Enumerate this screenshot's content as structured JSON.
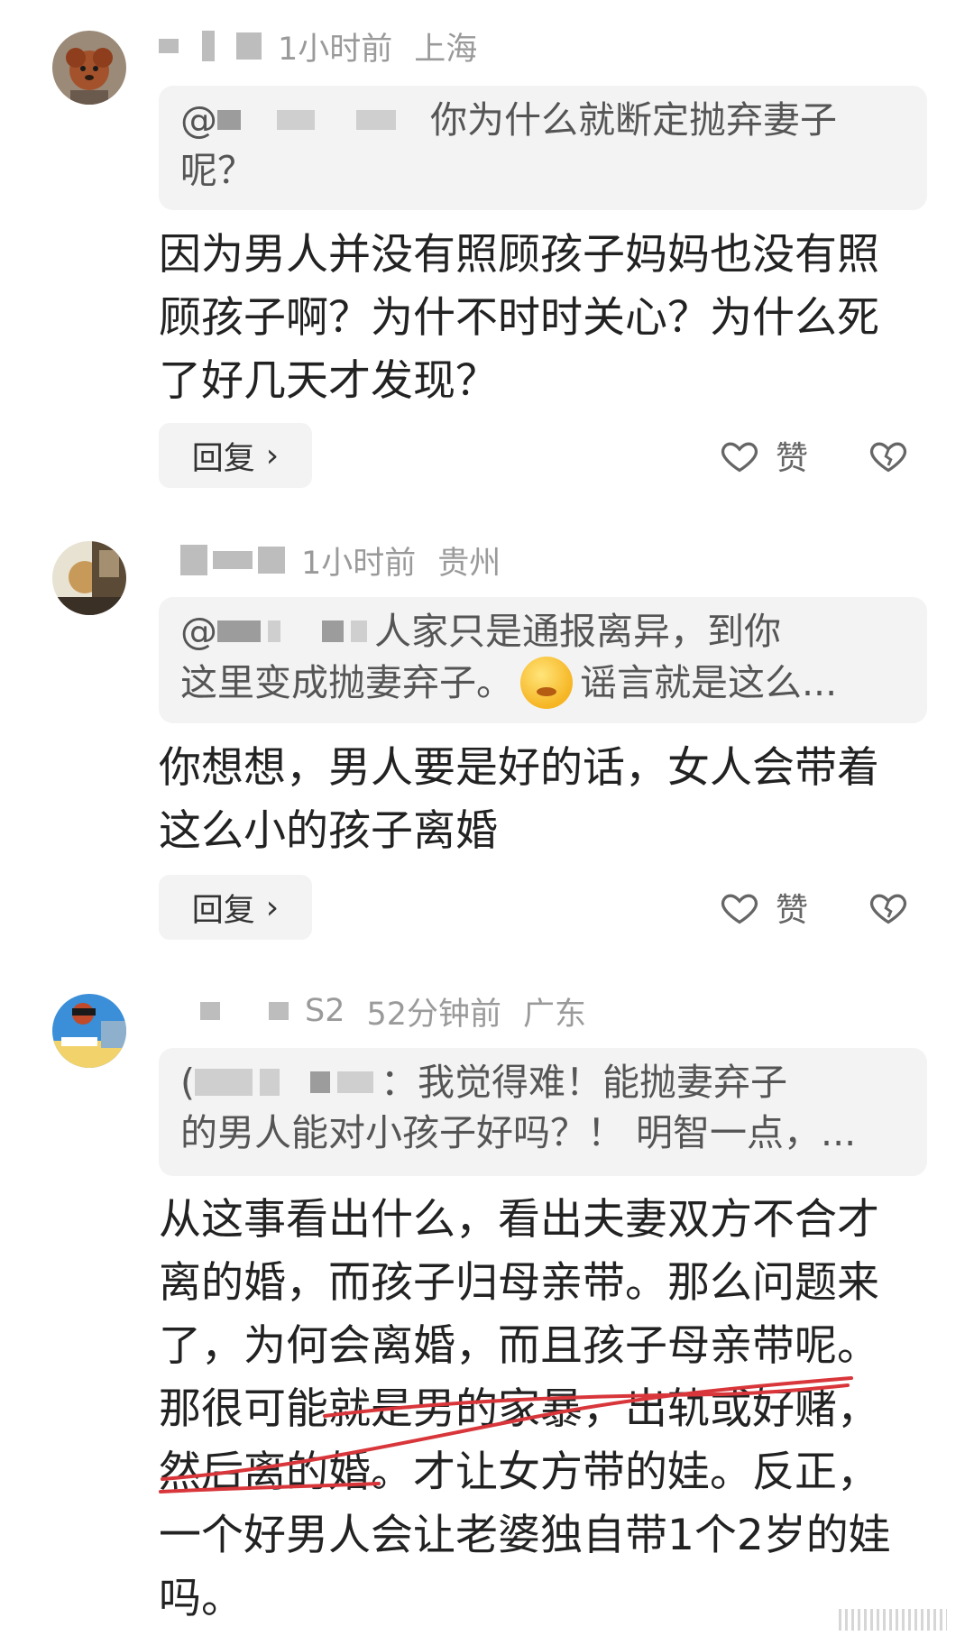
{
  "comments": [
    {
      "time": "1小时前",
      "location": "上海",
      "quote_text_1": "你为什么就断定抛弃妻子",
      "quote_text_2": "呢？",
      "body": [
        "因为男人并没有照顾孩子妈妈也没有照",
        "顾孩子啊？为什不时时关心？为什么死",
        "了好几天才发现？"
      ],
      "reply_label": "回复",
      "like_label": "赞"
    },
    {
      "time": "1小时前",
      "location": "贵州",
      "quote_text_1": "人家只是通报离异，到你",
      "quote_text_2a": "这里变成抛妻弃子。",
      "quote_text_2b": "谣言就是这么...",
      "body": [
        "你想想，男人要是好的话，女人会带着",
        "这么小的孩子离婚"
      ],
      "reply_label": "回复",
      "like_label": "赞"
    },
    {
      "name_suffix": "S2",
      "time": "52分钟前",
      "location": "广东",
      "quote_text_1": "：我觉得难！能抛妻弃子",
      "quote_text_2": "的男人能对小孩子好吗？！ 明智一点，...",
      "body": [
        "从这事看出什么，看出夫妻双方不合才",
        "离的婚，而孩子归母亲带。那么问题来",
        "了，为何会离婚，而且孩子母亲带呢。",
        "那很可能就是男的家暴，出轨或好赌，",
        "然后离的婚。才让女方带的娃。反正，",
        "一个好男人会让老婆独自带1个2岁的娃",
        "吗。"
      ]
    }
  ],
  "icons": {
    "like": "heart-outline-icon",
    "dislike": "broken-heart-icon",
    "reply_chevron": "chevron-right-icon"
  },
  "colors": {
    "meta_gray": "#9a9a9a",
    "quote_bg": "#f3f3f3",
    "annotation_red": "#d8363a"
  }
}
